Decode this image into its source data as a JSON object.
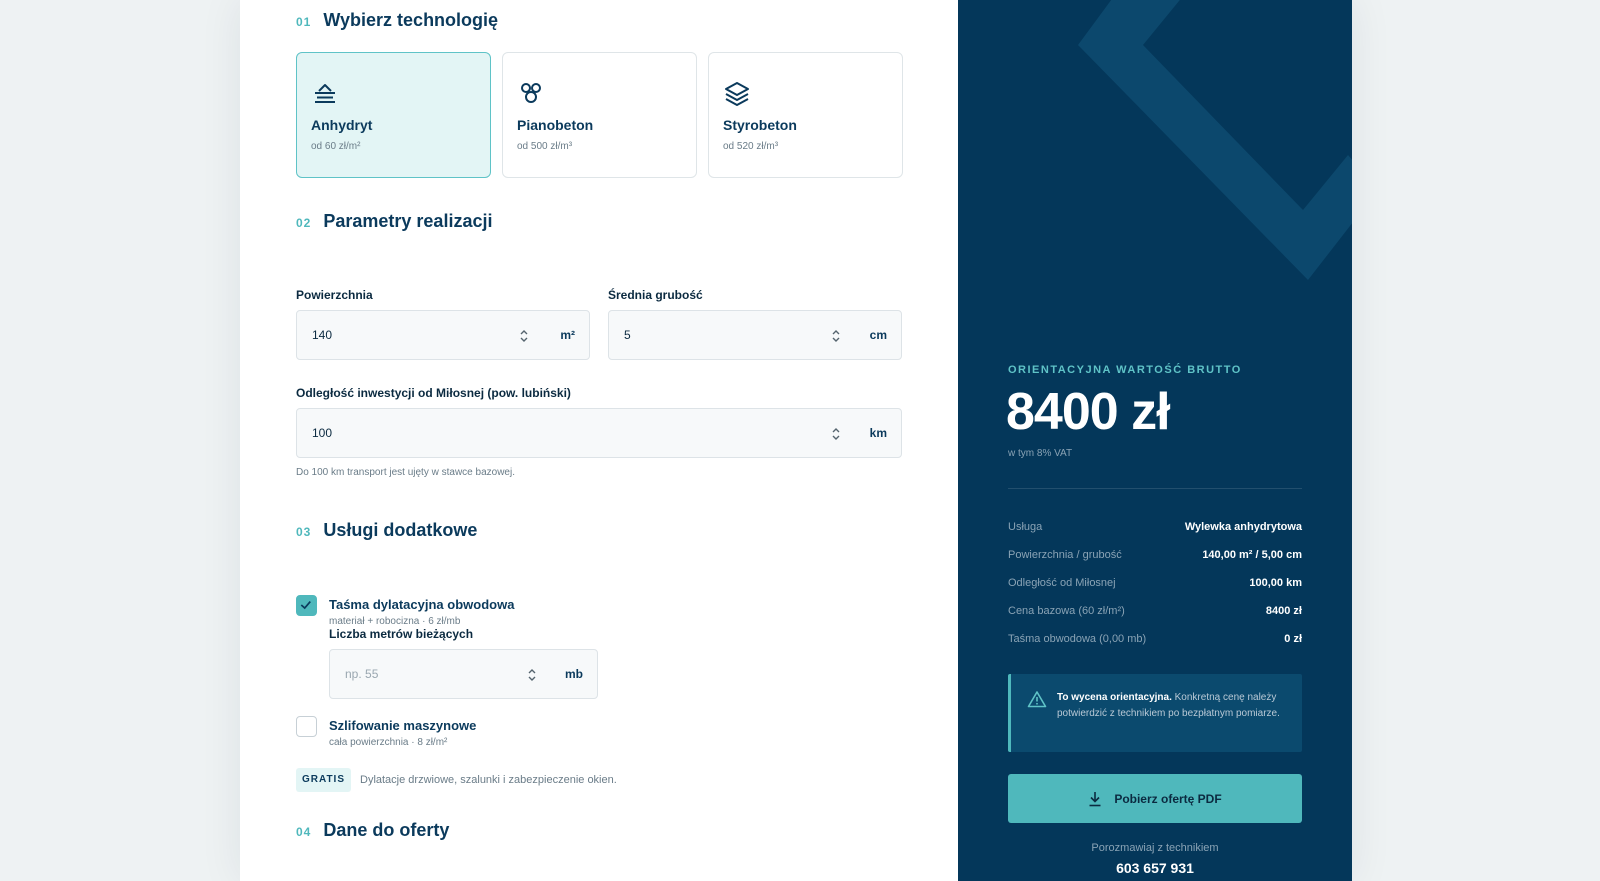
{
  "sections": {
    "s1": {
      "num": "01",
      "title": "Wybierz technologię"
    },
    "s2": {
      "num": "02",
      "title": "Parametry realizacji"
    },
    "s3": {
      "num": "03",
      "title": "Usługi dodatkowe"
    },
    "s4": {
      "num": "04",
      "title": "Dane do oferty"
    }
  },
  "technologies": [
    {
      "name": "Anhydryt",
      "price": "od 60 zł/m²",
      "icon": "floor-pour-icon",
      "selected": true
    },
    {
      "name": "Pianobeton",
      "price": "od 500 zł/m³",
      "icon": "bubbles-icon",
      "selected": false
    },
    {
      "name": "Styrobeton",
      "price": "od 520 zł/m³",
      "icon": "layers-icon",
      "selected": false
    }
  ],
  "params": {
    "area": {
      "label": "Powierzchnia",
      "value": "140",
      "unit": "m²"
    },
    "thickness": {
      "label": "Średnia grubość",
      "value": "5",
      "unit": "cm"
    },
    "distance": {
      "label": "Odległość inwestycji od Miłosnej (pow. lubiński)",
      "value": "100",
      "unit": "km",
      "hint": "Do 100 km transport jest ujęty w stawce bazowej."
    }
  },
  "extras": {
    "tape": {
      "title": "Taśma dylatacyjna obwodowa",
      "sub": "materiał + robocizna · 6 zł/mb",
      "checked": true,
      "meters_label": "Liczba metrów bieżących",
      "meters_placeholder": "np. 55",
      "meters_unit": "mb"
    },
    "grinding": {
      "title": "Szlifowanie maszynowe",
      "sub": "cała powierzchnia · 8 zł/m²",
      "checked": false
    },
    "gratis_badge": "GRATIS",
    "gratis_text": "Dylatacje drzwiowe, szalunki i zabezpieczenie okien."
  },
  "summary": {
    "caption": "ORIENTACYJNA WARTOŚĆ BRUTTO",
    "total": "8400 zł",
    "vat": "w tym 8% VAT",
    "rows": [
      {
        "k": "Usługa",
        "v": "Wylewka anhydrytowa"
      },
      {
        "k": "Powierzchnia / grubość",
        "v": "140,00 m² / 5,00 cm"
      },
      {
        "k": "Odległość od Miłosnej",
        "v": "100,00 km"
      },
      {
        "k": "Cena bazowa (60 zł/m²)",
        "v": "8400 zł"
      },
      {
        "k": "Taśma obwodowa (0,00 mb)",
        "v": "0 zł"
      }
    ],
    "note_bold": "To wycena orientacyjna.",
    "note_text": " Konkretną cenę należy potwierdzić z technikiem po bezpłatnym pomiarze.",
    "pdf_button": "Pobierz ofertę PDF",
    "talk": "Porozmawiaj z technikiem",
    "phone": "603 657 931"
  },
  "colors": {
    "navy": "#04375a",
    "teal": "#4fb8bc",
    "teal_light": "#e3f5f5",
    "text_dark": "#0b3a5c"
  }
}
